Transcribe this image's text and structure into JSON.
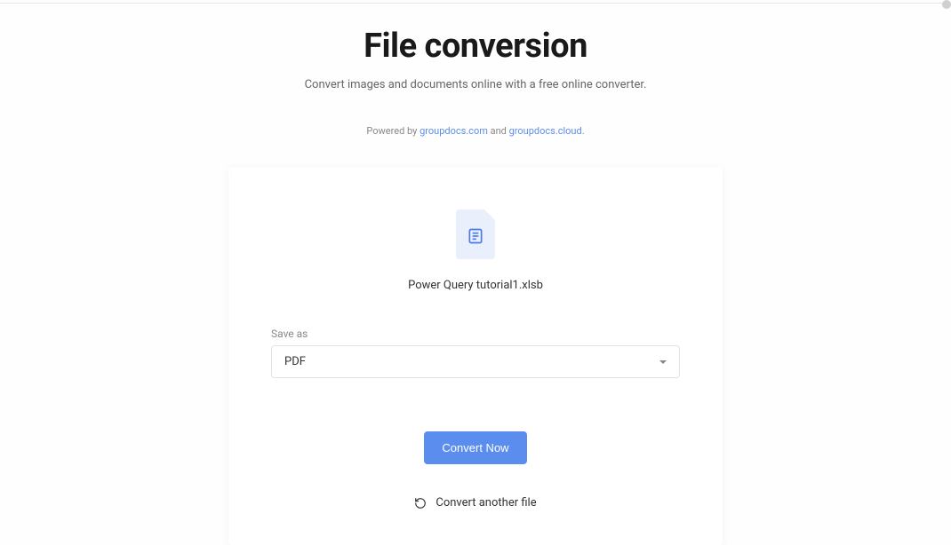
{
  "header": {
    "title": "File conversion",
    "subtitle": "Convert images and documents online with a free online converter.",
    "powered_prefix": "Powered by ",
    "powered_link1": "groupdocs.com",
    "powered_mid": " and ",
    "powered_link2": "groupdocs.cloud",
    "powered_suffix": "."
  },
  "file": {
    "name": "Power Query tutorial1.xlsb"
  },
  "saveAs": {
    "label": "Save as",
    "selected": "PDF"
  },
  "actions": {
    "convert": "Convert Now",
    "another": "Convert another file"
  }
}
